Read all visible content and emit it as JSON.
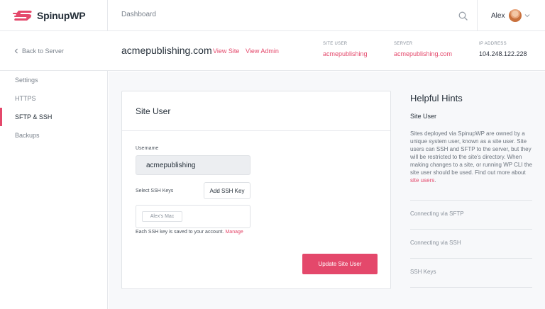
{
  "app": {
    "brand": "SpinupWP",
    "colors": {
      "accent": "#e4486b",
      "text": "#26303a",
      "muted": "#7a828c"
    }
  },
  "topbar": {
    "nav_dashboard": "Dashboard",
    "search_icon": "search-icon",
    "user_name": "Alex"
  },
  "subheader": {
    "back_label": "Back to Server",
    "site_title": "acmepublishing.com",
    "view_site": "View Site",
    "view_admin": "View Admin",
    "meta": [
      {
        "label": "SITE USER",
        "value": "acmepublishing"
      },
      {
        "label": "SERVER",
        "value": "acmepublishing.com"
      },
      {
        "label": "IP ADDRESS",
        "value": "104.248.122.228"
      }
    ]
  },
  "sidebar": {
    "items": [
      {
        "label": "Settings",
        "active": false
      },
      {
        "label": "HTTPS",
        "active": false
      },
      {
        "label": "SFTP & SSH",
        "active": true
      },
      {
        "label": "Backups",
        "active": false
      }
    ]
  },
  "card": {
    "title": "Site User",
    "username_label": "Username",
    "username_value": "acmepublishing",
    "ssh_keys_label": "Select SSH Keys",
    "add_key_button": "Add SSH Key",
    "selected_key": "Alex's Mac",
    "help_prefix": "Each SSH key is saved to your account.",
    "help_link": "Manage",
    "submit_button": "Update Site User"
  },
  "hints": {
    "title": "Helpful Hints",
    "active_heading": "Site User",
    "body": "Sites deployed via SpinupWP are owned by a unique system user, known as a site user. Site users can SSH and SFTP to the server, but they will be restricted to the site's directory. When making changes to a site, or running WP CLI the site user should be used. Find out more about",
    "body_link": "site users",
    "body_suffix": ".",
    "items": [
      "Connecting via SFTP",
      "Connecting via SSH",
      "SSH Keys"
    ]
  }
}
